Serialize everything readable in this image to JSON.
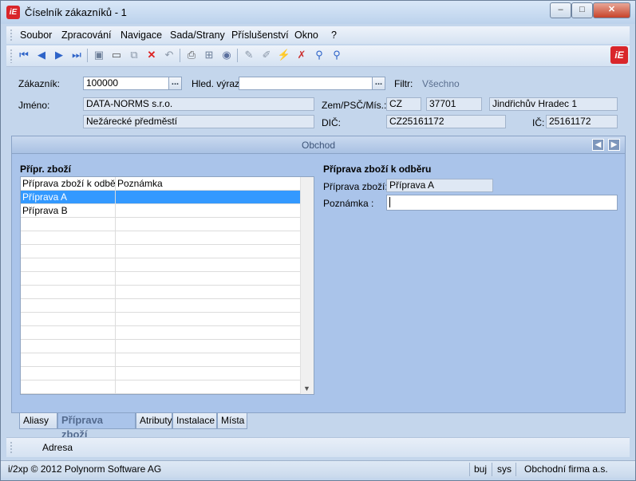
{
  "window": {
    "title": "Číselník zákazníků - 1",
    "logo": "iE",
    "buttons": {
      "minimize": "–",
      "maximize": "□",
      "close": "✕"
    }
  },
  "menu": [
    "Soubor",
    "Zpracování",
    "Navigace",
    "Sada/Strany",
    "Příslušenství",
    "Okno",
    "?"
  ],
  "toolbar": {
    "icons": [
      "first-icon",
      "prev-icon",
      "next-icon",
      "last-icon",
      "save-icon",
      "new-icon",
      "copy-icon",
      "delete-icon",
      "undo-icon",
      "print-icon",
      "tree-icon",
      "refresh-icon",
      "edit-icon",
      "edit-all-icon",
      "filter-icon",
      "clear-filter-icon",
      "search-icon",
      "search-advanced-icon"
    ]
  },
  "header": {
    "customer_label": "Zákazník:",
    "customer_value": "100000",
    "search_label": "Hled. výraz:",
    "search_value": "",
    "filter_label": "Filtr:",
    "filter_value": "Všechno",
    "name_label": "Jméno:",
    "name_line1": "DATA-NORMS s.r.o.",
    "name_line2": "Nežárecké předměstí",
    "zip_label": "Zem/PSČ/Mís.:",
    "country": "CZ",
    "zip": "37701",
    "city": "Jindřichův Hradec 1",
    "dic_label": "DIČ:",
    "dic_value": "CZ25161172",
    "ic_label": "IČ:",
    "ic_value": "25161172",
    "ellipsis": "..."
  },
  "panel": {
    "title": "Obchod",
    "list_title": "Přípr. zboží",
    "columns": [
      "Příprava zboží k odběru",
      "Poznámka"
    ],
    "rows": [
      {
        "prep": "Příprava A",
        "note": "",
        "selected": true
      },
      {
        "prep": "Příprava B",
        "note": "",
        "selected": false
      }
    ],
    "detail_title": "Příprava zboží k odběru",
    "detail_prep_label": "Příprava zboží:",
    "detail_prep_value": "Příprava A",
    "detail_note_label": "Poznámka :",
    "detail_note_value": ""
  },
  "tabs": [
    "Aliasy",
    "Příprava zboží",
    "Atributy",
    "Instalace",
    "Místa"
  ],
  "active_tab": "Příprava zboží",
  "address_label": "Adresa",
  "status": {
    "copyright": "i/2xp © 2012 Polynorm Software AG",
    "user": "buj",
    "db": "sys",
    "company": "Obchodní firma a.s."
  },
  "colors": {
    "accent": "#3399ff",
    "panel": "#aac4ea",
    "logo": "#d9262b"
  }
}
